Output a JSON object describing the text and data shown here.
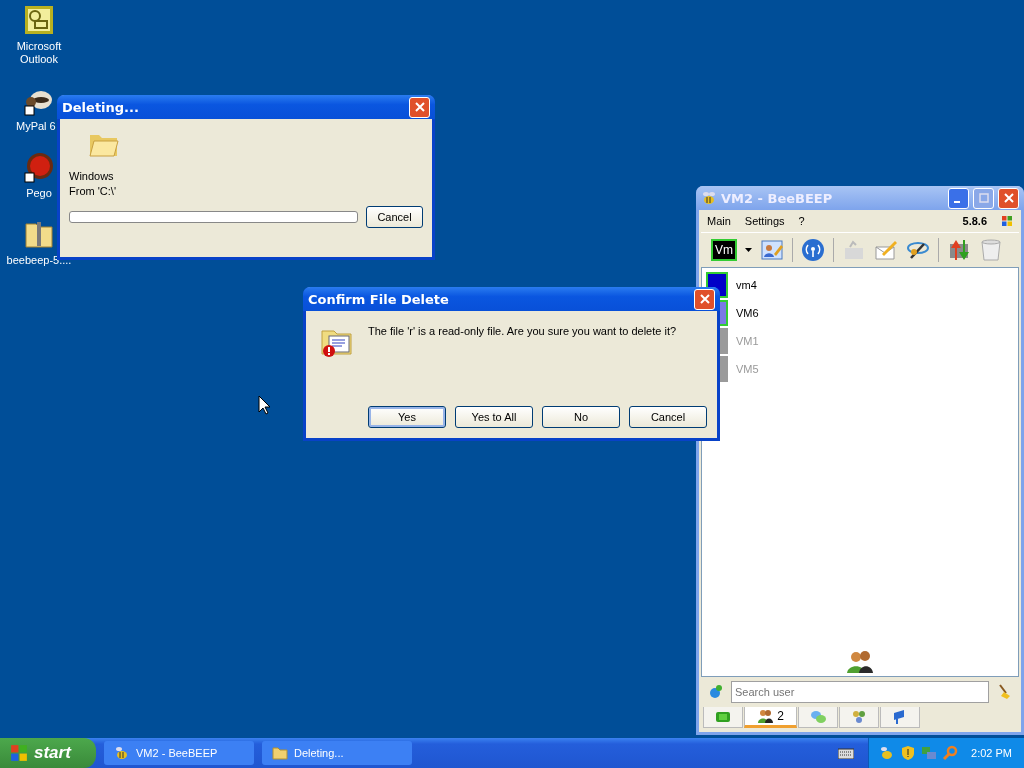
{
  "desktop_icons": [
    {
      "label": "Microsoft Outlook",
      "kind": "outlook"
    },
    {
      "label": "MyPal 6",
      "kind": "raccoon"
    },
    {
      "label": "Pego",
      "kind": "ball"
    },
    {
      "label": "beebeep-5....",
      "kind": "zip"
    }
  ],
  "deleting_window": {
    "title": "Deleting...",
    "item": "Windows",
    "from": "From 'C:\\'",
    "progress": {
      "level": 0
    },
    "cancel": "Cancel"
  },
  "confirm_dialog": {
    "title": "Confirm File Delete",
    "message": "The file 'r' is a read-only file. Are you sure you want to delete it?",
    "buttons": [
      {
        "label": "Yes",
        "selected": true
      },
      {
        "label": "Yes to All",
        "selected": false
      },
      {
        "label": "No",
        "selected": false
      },
      {
        "label": "Cancel",
        "selected": false
      }
    ]
  },
  "beebeep_window": {
    "title": "VM2 - BeeBEEP",
    "menu": [
      "Main",
      "Settings",
      "?"
    ],
    "version": "5.8.6",
    "toolbar_avatar": "Vm",
    "users": [
      {
        "name": "vm4",
        "online": true,
        "color": "#0000c8"
      },
      {
        "name": "VM6",
        "online": true,
        "color": "#7a7ae6"
      },
      {
        "name": "VM1",
        "online": false,
        "color": "#9a9a9a"
      },
      {
        "name": "VM5",
        "online": false,
        "color": "#9a9a9a"
      }
    ],
    "search": {
      "placeholder": "Search user"
    },
    "tabs": [
      {
        "kind": "chat",
        "selected": false
      },
      {
        "kind": "users",
        "count": "2",
        "selected": true
      },
      {
        "kind": "messages",
        "selected": false
      },
      {
        "kind": "groups",
        "selected": false
      },
      {
        "kind": "share",
        "selected": false
      }
    ]
  },
  "taskbar": {
    "start": "start",
    "tasks": [
      {
        "label": "VM2 - BeeBEEP",
        "kind": "bee",
        "selected": false
      },
      {
        "label": "Deleting...",
        "kind": "folder",
        "selected": false
      }
    ],
    "clock": "2:02 PM"
  }
}
